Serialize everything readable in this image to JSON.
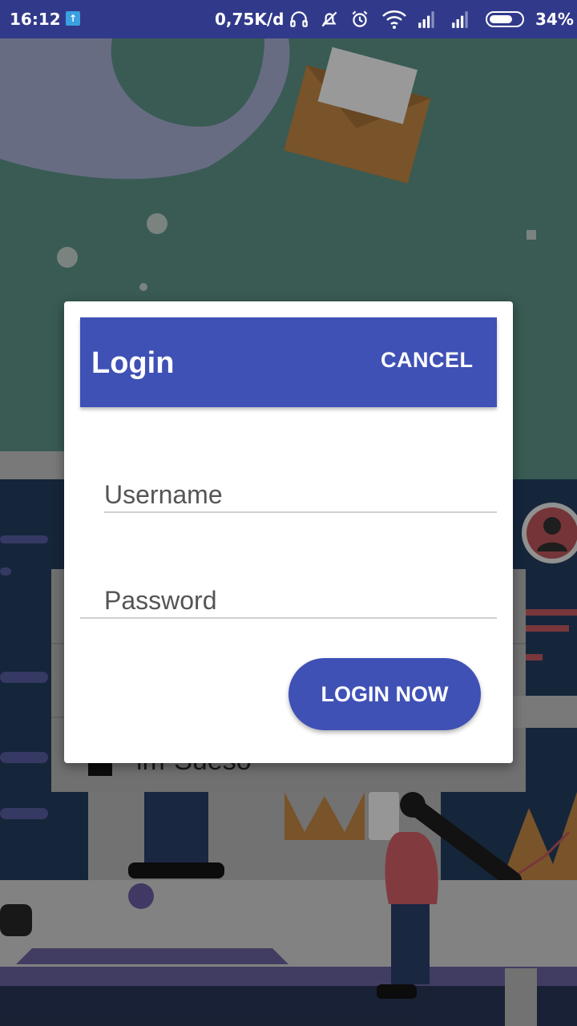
{
  "status_bar": {
    "time": "16:12",
    "upload_icon": "upload-arrow-icon",
    "network_speed": "0,75K/d",
    "icons": [
      "headphones-icon",
      "alarm-off-icon",
      "alarm-clock-icon",
      "wifi-icon",
      "signal-icon",
      "signal-icon"
    ],
    "battery_percent": "34%"
  },
  "dialog": {
    "title": "Login",
    "cancel_label": "CANCEL",
    "username_placeholder": "Username",
    "password_placeholder": "Password",
    "login_button_label": "LOGIN NOW"
  },
  "colors": {
    "primary": "#3f51b5",
    "status_bar": "#313a8a",
    "background_teal": "#4f7e74",
    "background_navy": "#1e3552"
  }
}
